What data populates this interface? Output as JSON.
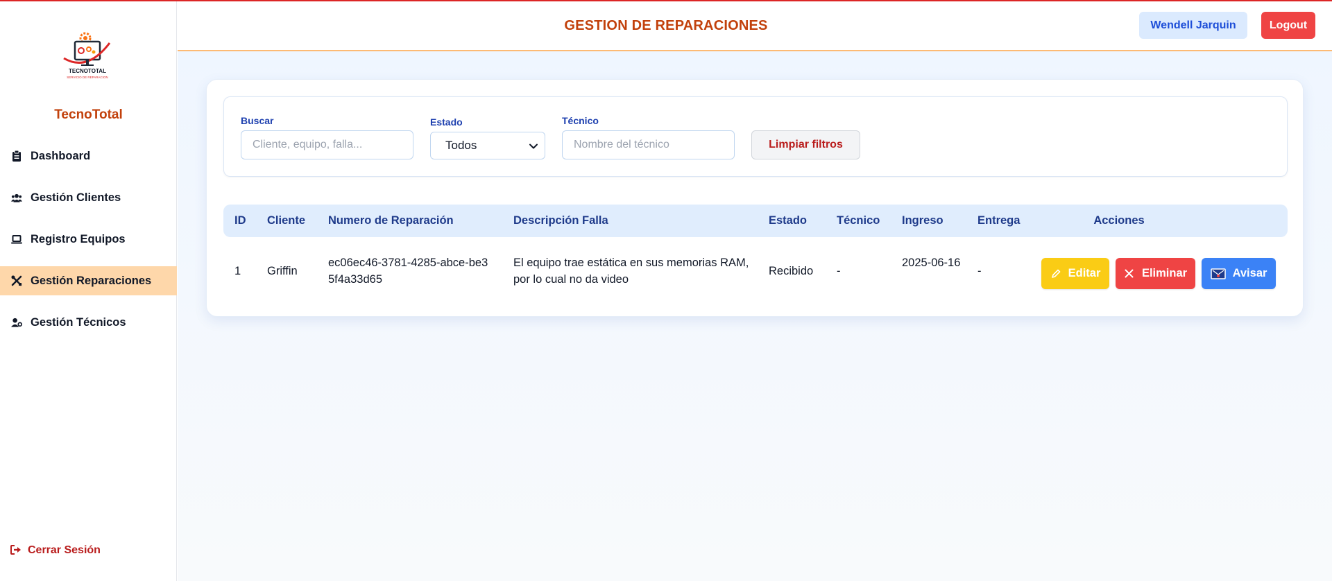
{
  "app": {
    "brand": "TecnoTotal",
    "logo_text": "TECNOTOTAL",
    "logo_subtext": "SERVICIO DE REPARACION",
    "colors": {
      "brand": "#c2410c",
      "header_border": "#fdba74",
      "active_nav": "#fed7aa",
      "danger": "#ef4444",
      "warning": "#facc15",
      "primary": "#3b82f6"
    }
  },
  "sidebar": {
    "items": [
      {
        "label": "Dashboard",
        "icon": "clipboard-icon",
        "active": false
      },
      {
        "label": "Gestión Clientes",
        "icon": "users-icon",
        "active": false
      },
      {
        "label": "Registro Equipos",
        "icon": "laptop-icon",
        "active": false
      },
      {
        "label": "Gestión Reparaciones",
        "icon": "tools-icon",
        "active": true
      },
      {
        "label": "Gestión Técnicos",
        "icon": "user-gear-icon",
        "active": false
      }
    ],
    "logout_label": "Cerrar Sesión"
  },
  "header": {
    "title": "GESTION DE REPARACIONES",
    "user_name": "Wendell Jarquin",
    "logout_label": "Logout"
  },
  "filters": {
    "search": {
      "label": "Buscar",
      "placeholder": "Cliente, equipo, falla..."
    },
    "status": {
      "label": "Estado",
      "selected": "Todos"
    },
    "technician": {
      "label": "Técnico",
      "placeholder": "Nombre del técnico"
    },
    "clear_label": "Limpiar filtros"
  },
  "table": {
    "headers": [
      "ID",
      "Cliente",
      "Numero de Reparación",
      "Descripción Falla",
      "Estado",
      "Técnico",
      "Ingreso",
      "Entrega",
      "Acciones"
    ],
    "rows": [
      {
        "id": "1",
        "cliente": "Griffin",
        "numero": "ec06ec46-3781-4285-abce-be35f4a33d65",
        "descripcion": "El equipo trae estática en sus memorias RAM, por lo cual no da video",
        "estado": "Recibido",
        "tecnico": "-",
        "ingreso": "2025-06-16",
        "entrega": "-",
        "actions": {
          "edit": "Editar",
          "delete": "Eliminar",
          "notify": "Avisar"
        }
      }
    ]
  }
}
